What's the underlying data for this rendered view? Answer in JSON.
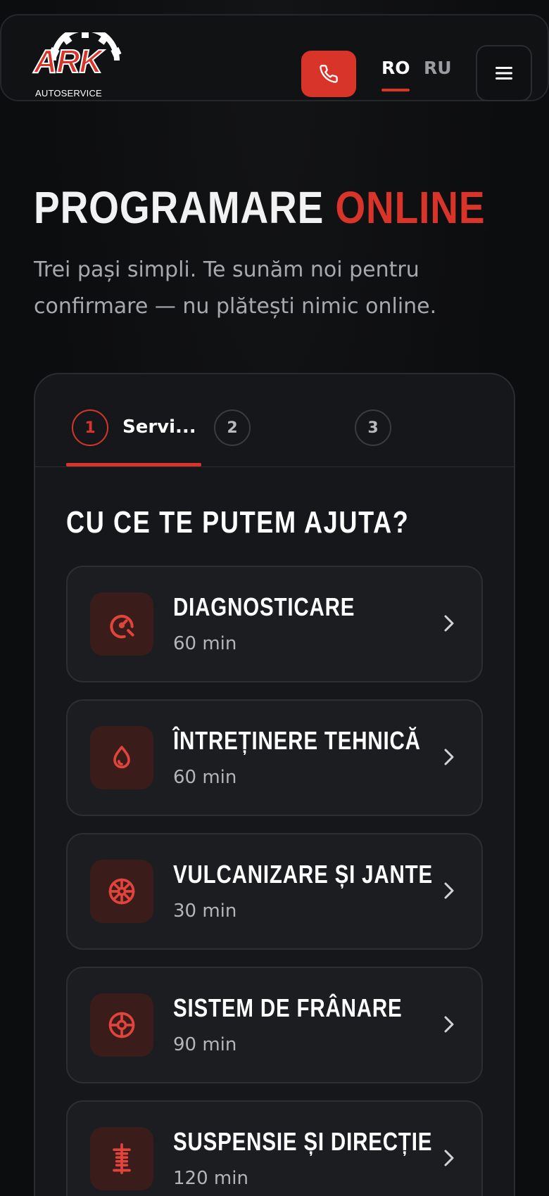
{
  "header": {
    "logo": {
      "brand": "ARK",
      "sub": "AUTOSERVICE"
    },
    "phone_icon": "phone-icon",
    "languages": [
      {
        "code": "RO",
        "active": true
      },
      {
        "code": "RU",
        "active": false
      }
    ],
    "menu_icon": "hamburger-icon"
  },
  "hero": {
    "title_main": "PROGRAMARE",
    "title_accent": "ONLINE",
    "subtitle_line1": "Trei pași simpli. Te sunăm noi pentru",
    "subtitle_line2": "confirmare — nu plătești nimic online."
  },
  "wizard": {
    "steps": [
      {
        "number": "1",
        "label": "Servi...",
        "active": true
      },
      {
        "number": "2",
        "label": "",
        "active": false
      },
      {
        "number": "3",
        "label": "",
        "active": false
      }
    ],
    "section_title": "CU CE TE PUTEM AJUTA?",
    "services": [
      {
        "name": "DIAGNOSTICARE",
        "duration": "60 min",
        "icon": "speedometer-icon"
      },
      {
        "name": "ÎNTREȚINERE TEHNICĂ",
        "duration": "60 min",
        "icon": "oil-drop-icon"
      },
      {
        "name": "VULCANIZARE ȘI JANTE",
        "duration": "30 min",
        "icon": "wheel-icon"
      },
      {
        "name": "SISTEM DE FRÂNARE",
        "duration": "90 min",
        "icon": "brake-disc-icon"
      },
      {
        "name": "SUSPENSIE ȘI DIRECȚIE",
        "duration": "120 min",
        "icon": "shock-absorber-icon"
      }
    ]
  },
  "colors": {
    "accent": "#d8342a",
    "background": "#0c0d0f",
    "card": "#15171a",
    "service_card": "#1b1d20",
    "icon_bg": "#3a1c1b"
  }
}
